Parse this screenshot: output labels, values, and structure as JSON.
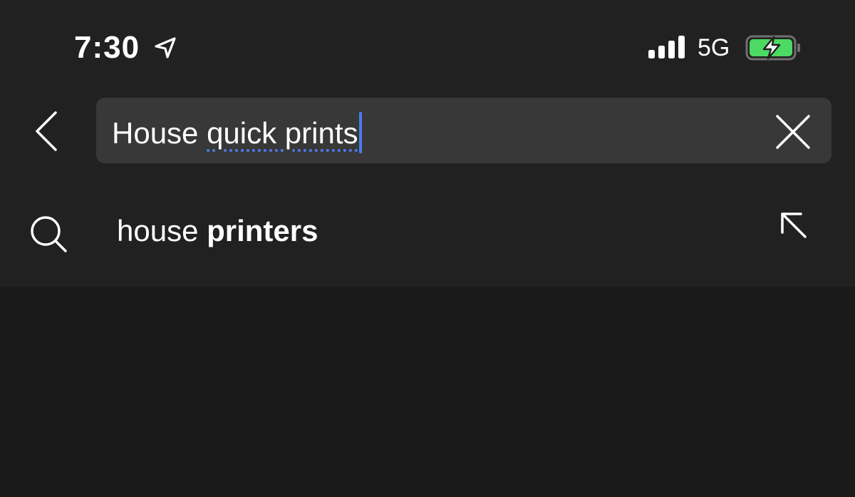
{
  "status_bar": {
    "time": "7:30",
    "network": "5G",
    "battery_color": "#4cd964",
    "icons": [
      "location-arrow-icon",
      "signal-bars-icon",
      "battery-charging-icon"
    ]
  },
  "search": {
    "query_prefix": "House ",
    "query_misspelled": "quick prints",
    "back_icon": "chevron-left-icon",
    "clear_icon": "close-icon",
    "caret_color": "#4b7bf0"
  },
  "suggestions": [
    {
      "prefix": "house ",
      "completion": "printers",
      "icon": "search-icon",
      "action_icon": "arrow-up-left-icon"
    }
  ]
}
